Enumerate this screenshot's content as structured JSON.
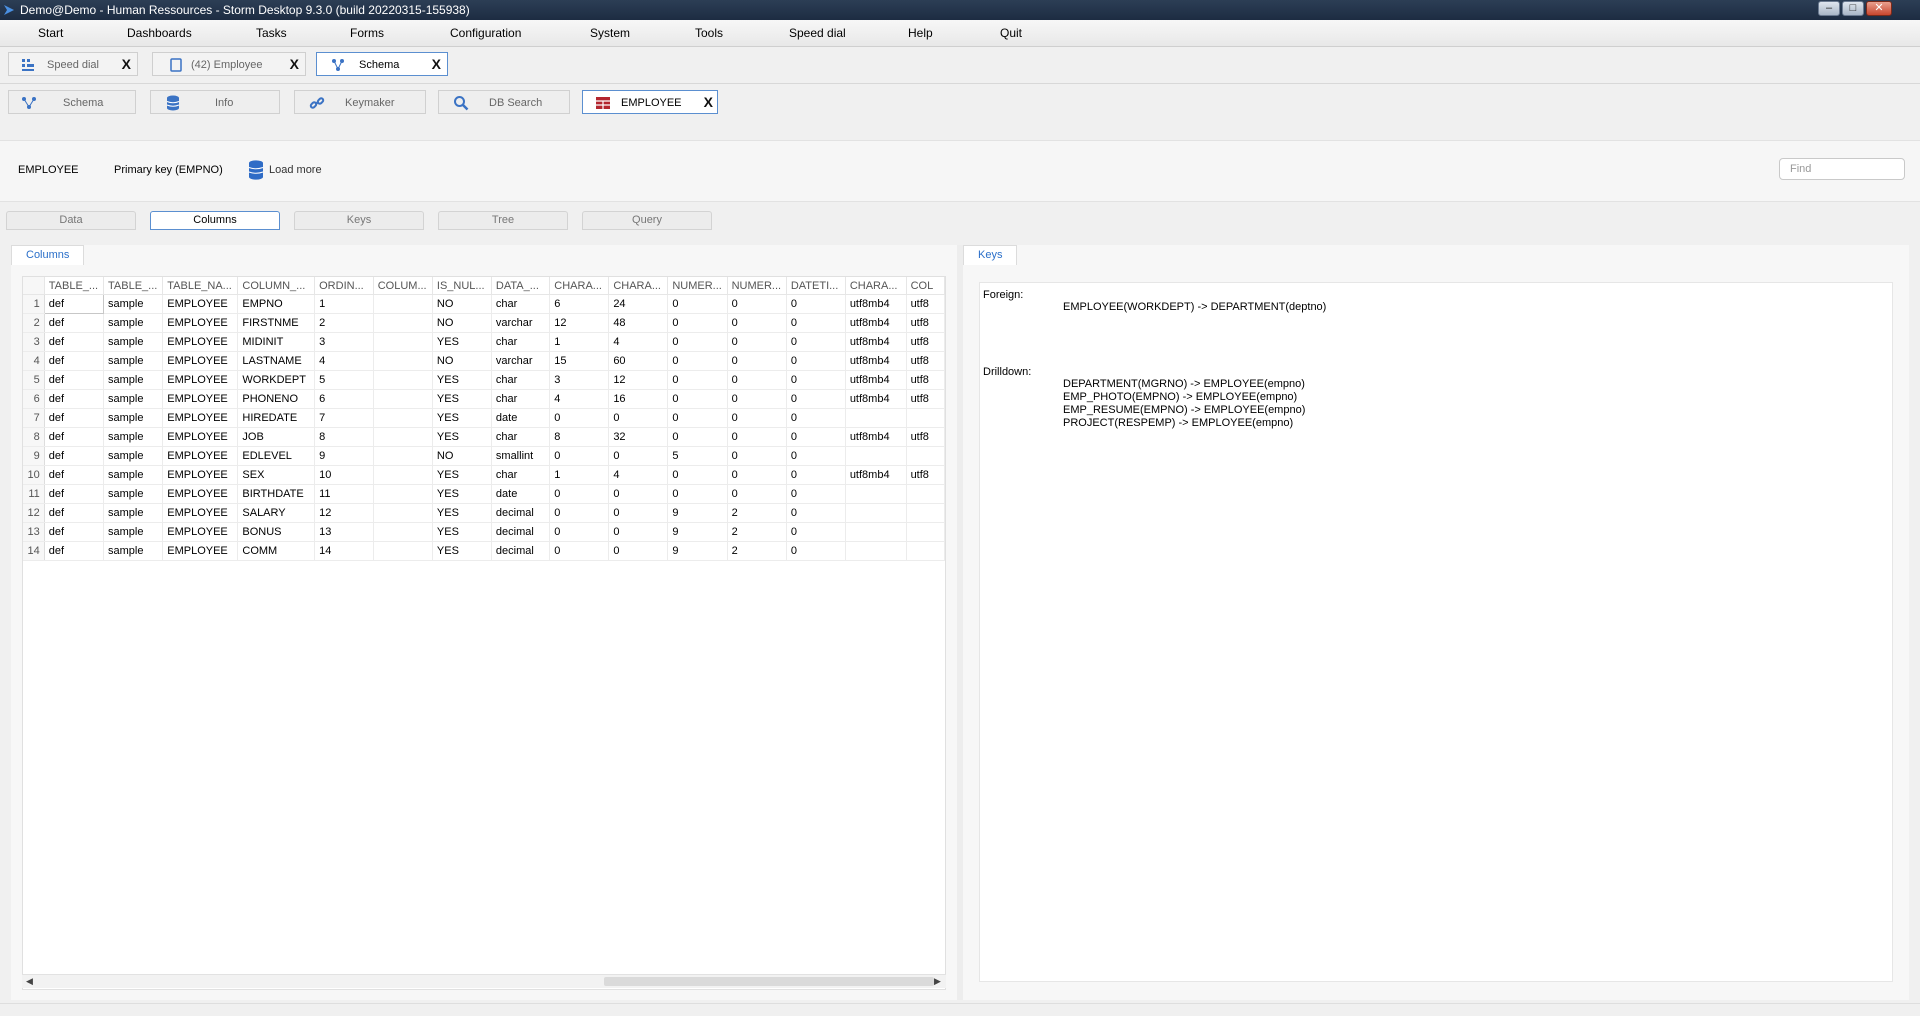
{
  "window": {
    "title": "Demo@Demo - Human Ressources - Storm Desktop 9.3.0 (build 20220315-155938)",
    "controls": {
      "minimize": "–",
      "maximize": "□",
      "close": "✕"
    }
  },
  "menu": [
    "Start",
    "Dashboards",
    "Tasks",
    "Forms",
    "Configuration",
    "System",
    "Tools",
    "Speed dial",
    "Help",
    "Quit"
  ],
  "doc_tabs": [
    {
      "label": "Speed dial",
      "icon": "speed-dial-icon",
      "close": "X"
    },
    {
      "label": "(42) Employee",
      "icon": "tablet-icon",
      "close": "X"
    },
    {
      "label": "Schema",
      "icon": "schema-icon",
      "close": "X",
      "active": true
    }
  ],
  "sub_tabs": [
    {
      "label": "Schema",
      "icon": "schema-icon"
    },
    {
      "label": "Info",
      "icon": "database-icon"
    },
    {
      "label": "Keymaker",
      "icon": "link-icon"
    },
    {
      "label": "DB Search",
      "icon": "search-icon"
    },
    {
      "label": "EMPLOYEE",
      "icon": "table-icon",
      "close": "X",
      "active": true
    }
  ],
  "info": {
    "table_name": "EMPLOYEE",
    "primary_key": "Primary key (EMPNO)",
    "load_more": "Load more",
    "find_placeholder": "Find"
  },
  "view_tabs": [
    {
      "label": "Data"
    },
    {
      "label": "Columns",
      "active": true
    },
    {
      "label": "Keys"
    },
    {
      "label": "Tree"
    },
    {
      "label": "Query"
    }
  ],
  "columns_panel": {
    "title": "Columns",
    "headers": [
      "TABLE_...",
      "TABLE_...",
      "TABLE_NA...",
      "COLUMN_...",
      "ORDIN...",
      "COLUM...",
      "IS_NUL...",
      "DATA_...",
      "CHARA...",
      "CHARA...",
      "NUMER...",
      "NUMER...",
      "DATETI...",
      "CHARA...",
      "COL"
    ],
    "rows": [
      [
        "1",
        "def",
        "sample",
        "EMPLOYEE",
        "EMPNO",
        "1",
        "",
        "NO",
        "char",
        "6",
        "24",
        "0",
        "0",
        "0",
        "utf8mb4",
        "utf8"
      ],
      [
        "2",
        "def",
        "sample",
        "EMPLOYEE",
        "FIRSTNME",
        "2",
        "",
        "NO",
        "varchar",
        "12",
        "48",
        "0",
        "0",
        "0",
        "utf8mb4",
        "utf8"
      ],
      [
        "3",
        "def",
        "sample",
        "EMPLOYEE",
        "MIDINIT",
        "3",
        "",
        "YES",
        "char",
        "1",
        "4",
        "0",
        "0",
        "0",
        "utf8mb4",
        "utf8"
      ],
      [
        "4",
        "def",
        "sample",
        "EMPLOYEE",
        "LASTNAME",
        "4",
        "",
        "NO",
        "varchar",
        "15",
        "60",
        "0",
        "0",
        "0",
        "utf8mb4",
        "utf8"
      ],
      [
        "5",
        "def",
        "sample",
        "EMPLOYEE",
        "WORKDEPT",
        "5",
        "",
        "YES",
        "char",
        "3",
        "12",
        "0",
        "0",
        "0",
        "utf8mb4",
        "utf8"
      ],
      [
        "6",
        "def",
        "sample",
        "EMPLOYEE",
        "PHONENO",
        "6",
        "",
        "YES",
        "char",
        "4",
        "16",
        "0",
        "0",
        "0",
        "utf8mb4",
        "utf8"
      ],
      [
        "7",
        "def",
        "sample",
        "EMPLOYEE",
        "HIREDATE",
        "7",
        "",
        "YES",
        "date",
        "0",
        "0",
        "0",
        "0",
        "0",
        "",
        ""
      ],
      [
        "8",
        "def",
        "sample",
        "EMPLOYEE",
        "JOB",
        "8",
        "",
        "YES",
        "char",
        "8",
        "32",
        "0",
        "0",
        "0",
        "utf8mb4",
        "utf8"
      ],
      [
        "9",
        "def",
        "sample",
        "EMPLOYEE",
        "EDLEVEL",
        "9",
        "",
        "NO",
        "smallint",
        "0",
        "0",
        "5",
        "0",
        "0",
        "",
        ""
      ],
      [
        "10",
        "def",
        "sample",
        "EMPLOYEE",
        "SEX",
        "10",
        "",
        "YES",
        "char",
        "1",
        "4",
        "0",
        "0",
        "0",
        "utf8mb4",
        "utf8"
      ],
      [
        "11",
        "def",
        "sample",
        "EMPLOYEE",
        "BIRTHDATE",
        "11",
        "",
        "YES",
        "date",
        "0",
        "0",
        "0",
        "0",
        "0",
        "",
        ""
      ],
      [
        "12",
        "def",
        "sample",
        "EMPLOYEE",
        "SALARY",
        "12",
        "",
        "YES",
        "decimal",
        "0",
        "0",
        "9",
        "2",
        "0",
        "",
        ""
      ],
      [
        "13",
        "def",
        "sample",
        "EMPLOYEE",
        "BONUS",
        "13",
        "",
        "YES",
        "decimal",
        "0",
        "0",
        "9",
        "2",
        "0",
        "",
        ""
      ],
      [
        "14",
        "def",
        "sample",
        "EMPLOYEE",
        "COMM",
        "14",
        "",
        "YES",
        "decimal",
        "0",
        "0",
        "9",
        "2",
        "0",
        "",
        ""
      ]
    ]
  },
  "keys_panel": {
    "title": "Keys",
    "foreign_label": "Foreign:",
    "foreign": [
      "EMPLOYEE(WORKDEPT) -> DEPARTMENT(deptno)"
    ],
    "drilldown_label": "Drilldown:",
    "drilldown": [
      "DEPARTMENT(MGRNO) -> EMPLOYEE(empno)",
      "EMP_PHOTO(EMPNO) -> EMPLOYEE(empno)",
      "EMP_RESUME(EMPNO) -> EMPLOYEE(empno)",
      "PROJECT(RESPEMP) -> EMPLOYEE(empno)"
    ]
  },
  "scroll": {
    "left": "◀",
    "right": "▶"
  }
}
